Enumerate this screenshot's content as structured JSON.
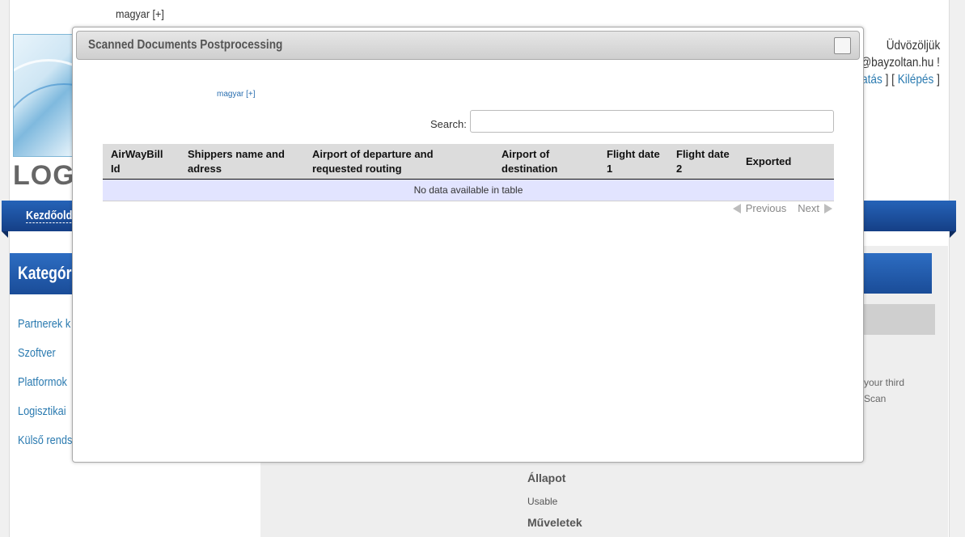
{
  "background": {
    "language_switcher": "magyar [+]",
    "logo_text": "LOG",
    "welcome": "Üdvözöljük",
    "user_email": "@bayzoltan.hu !",
    "user_links": {
      "open_bracket": "",
      "settings_partial": "atás",
      "separator": " ] [ ",
      "logout": "Kilépés",
      "close_bracket": " ]"
    },
    "nav_home": "Kezdőolda",
    "categories_header": "Kategóri",
    "sidebar_items": [
      "Partnerek k",
      "Szoftver",
      "Platformok",
      "Logisztikai",
      "Külső rends"
    ],
    "right_text_line1": "your third",
    "right_text_line2": "Scan",
    "status_label": "Állapot",
    "status_value": "Usable",
    "operations_label": "Műveletek"
  },
  "dialog": {
    "title": "Scanned Documents Postprocessing",
    "language_switcher": "magyar [+]",
    "search": {
      "label": "Search:",
      "value": "",
      "placeholder": ""
    },
    "table": {
      "columns": [
        "AirWayBill Id",
        "Shippers name and adress",
        "Airport of departure and requested routing",
        "Airport of destination",
        "Flight date 1",
        "Flight date 2",
        "Exported"
      ],
      "empty_message": "No data available in table"
    },
    "pager": {
      "previous": "Previous",
      "next": "Next"
    }
  }
}
